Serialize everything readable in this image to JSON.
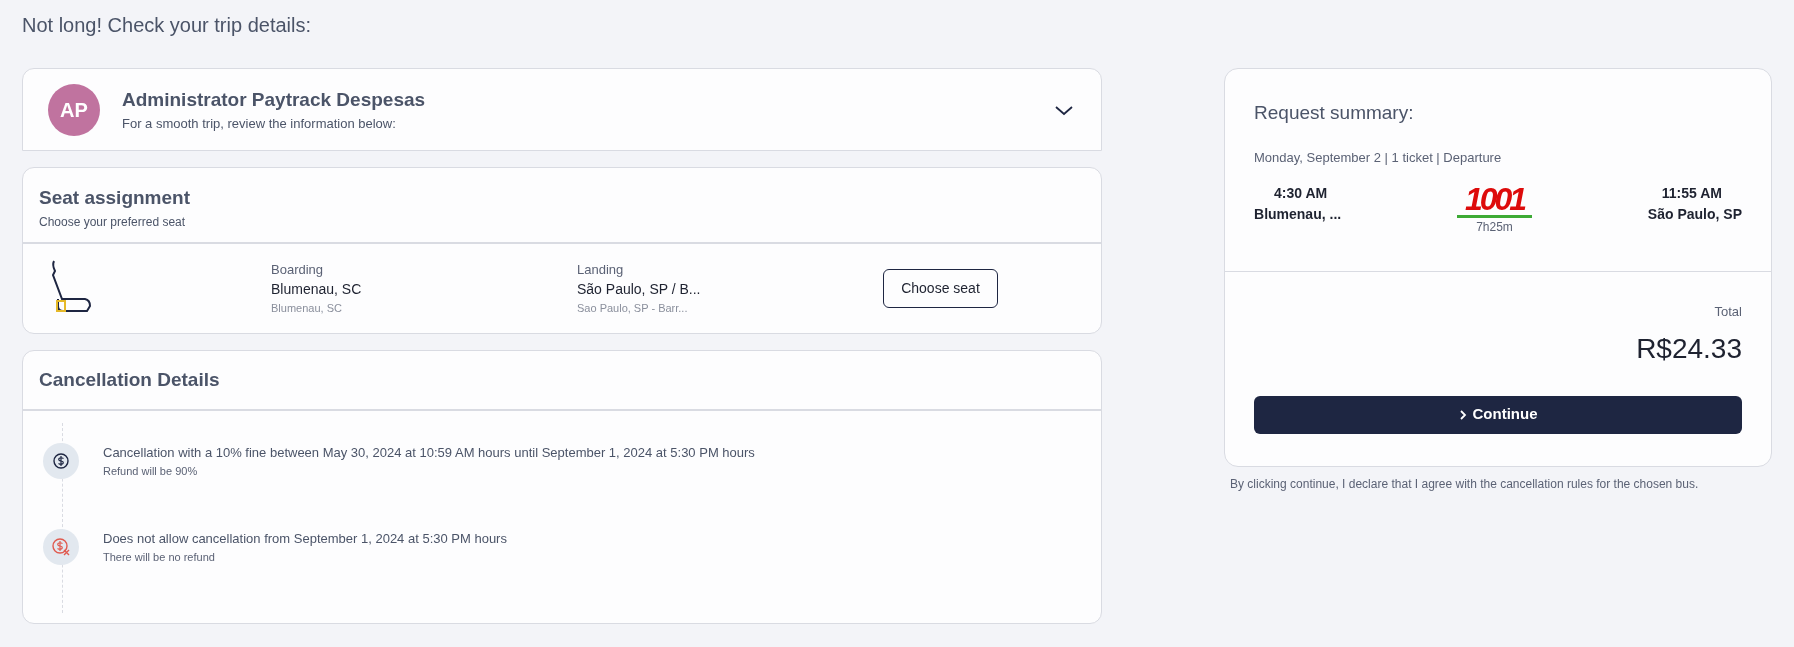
{
  "page_title": "Not long! Check your trip details:",
  "traveler": {
    "initials": "AP",
    "name": "Administrator Paytrack Despesas",
    "subtitle": "For a smooth trip, review the information below:",
    "expanded": false
  },
  "seat_assignment": {
    "title": "Seat assignment",
    "subtitle": "Choose your preferred seat",
    "boarding": {
      "label": "Boarding",
      "city": "Blumenau, SC",
      "detail": "Blumenau, SC"
    },
    "landing": {
      "label": "Landing",
      "city": "São Paulo, SP / B...",
      "detail": "Sao Paulo, SP - Barr..."
    },
    "button": "Choose seat"
  },
  "cancellation": {
    "title": "Cancellation Details",
    "items": [
      {
        "kind": "fine",
        "text": "Cancellation with a 10% fine between May 30, 2024 at 10:59 AM hours until September 1, 2024 at 5:30 PM hours",
        "note": "Refund will be 90%"
      },
      {
        "kind": "no_refund",
        "text": "Does not allow cancellation from September 1, 2024 at 5:30 PM hours",
        "note": "There will be no refund"
      }
    ]
  },
  "summary": {
    "title": "Request summary:",
    "trip_info": "Monday, September 2 | 1 ticket | Departure",
    "departure": {
      "time": "4:30 AM",
      "city": "Blumenau, ..."
    },
    "carrier_logo": "1001",
    "duration": "7h25m",
    "arrival": {
      "time": "11:55 AM",
      "city": "São Paulo, SP"
    },
    "total_label": "Total",
    "total": "R$24.33",
    "button": "Continue",
    "disclaimer": "By clicking continue, I declare that I agree with the cancellation rules for the chosen bus."
  }
}
